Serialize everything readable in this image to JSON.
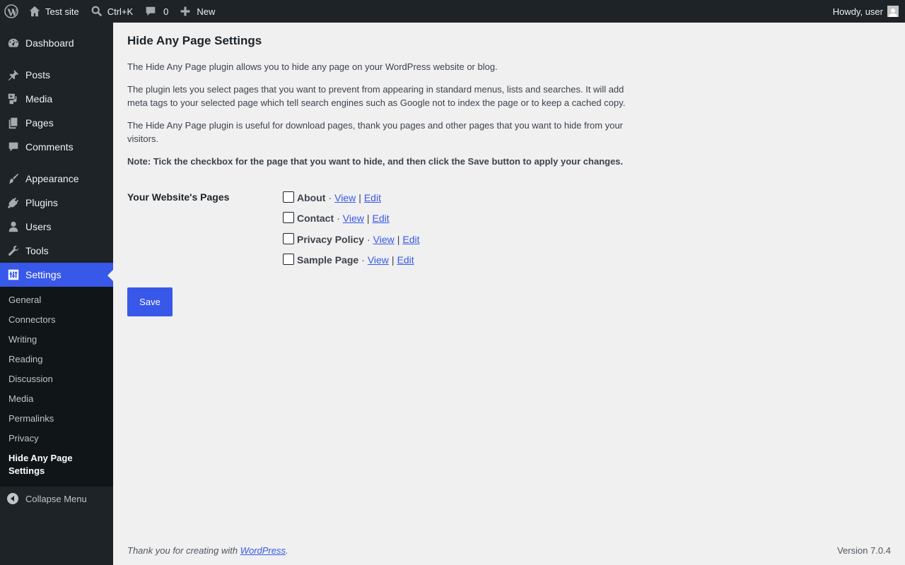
{
  "adminbar": {
    "site_name": "Test site",
    "search_shortcut": "Ctrl+K",
    "comments_count": "0",
    "new_label": "New",
    "howdy": "Howdy, user"
  },
  "sidebar": {
    "items": [
      {
        "label": "Dashboard",
        "icon": "dashboard-icon"
      },
      {
        "label": "Posts",
        "icon": "pin-icon"
      },
      {
        "label": "Media",
        "icon": "media-icon"
      },
      {
        "label": "Pages",
        "icon": "pages-icon"
      },
      {
        "label": "Comments",
        "icon": "comment-icon"
      },
      {
        "label": "Appearance",
        "icon": "brush-icon"
      },
      {
        "label": "Plugins",
        "icon": "plug-icon"
      },
      {
        "label": "Users",
        "icon": "user-icon"
      },
      {
        "label": "Tools",
        "icon": "wrench-icon"
      },
      {
        "label": "Settings",
        "icon": "settings-sliders-icon"
      }
    ],
    "submenu": [
      "General",
      "Connectors",
      "Writing",
      "Reading",
      "Discussion",
      "Media",
      "Permalinks",
      "Privacy",
      "Hide Any Page Settings"
    ],
    "collapse_label": "Collapse Menu"
  },
  "main": {
    "title": "Hide Any Page Settings",
    "paragraphs": [
      "The Hide Any Page plugin allows you to hide any page on your WordPress website or blog.",
      "The plugin lets you select pages that you want to prevent from appearing in standard menus, lists and searches. It will add meta tags to your selected page which tell search engines such as Google not to index the page or to keep a cached copy.",
      "The Hide Any Page plugin is useful for download pages, thank you pages and other pages that you want to hide from your visitors.",
      "Note: Tick the checkbox for the page that you want to hide, and then click the Save button to apply your changes."
    ],
    "pages_label": "Your Website's Pages",
    "pages": [
      {
        "name": "About",
        "view": "View",
        "edit": "Edit"
      },
      {
        "name": "Contact",
        "view": "View",
        "edit": "Edit"
      },
      {
        "name": "Privacy Policy",
        "view": "View",
        "edit": "Edit"
      },
      {
        "name": "Sample Page",
        "view": "View",
        "edit": "Edit"
      }
    ],
    "save_label": "Save"
  },
  "footer": {
    "thanks_prefix": "Thank you for creating with ",
    "thanks_link": "WordPress",
    "thanks_suffix": ".",
    "version": "Version 7.0.4"
  },
  "colors": {
    "accent": "#3858e9",
    "sidebar_bg": "#1d2327",
    "content_bg": "#f0f0f1"
  }
}
